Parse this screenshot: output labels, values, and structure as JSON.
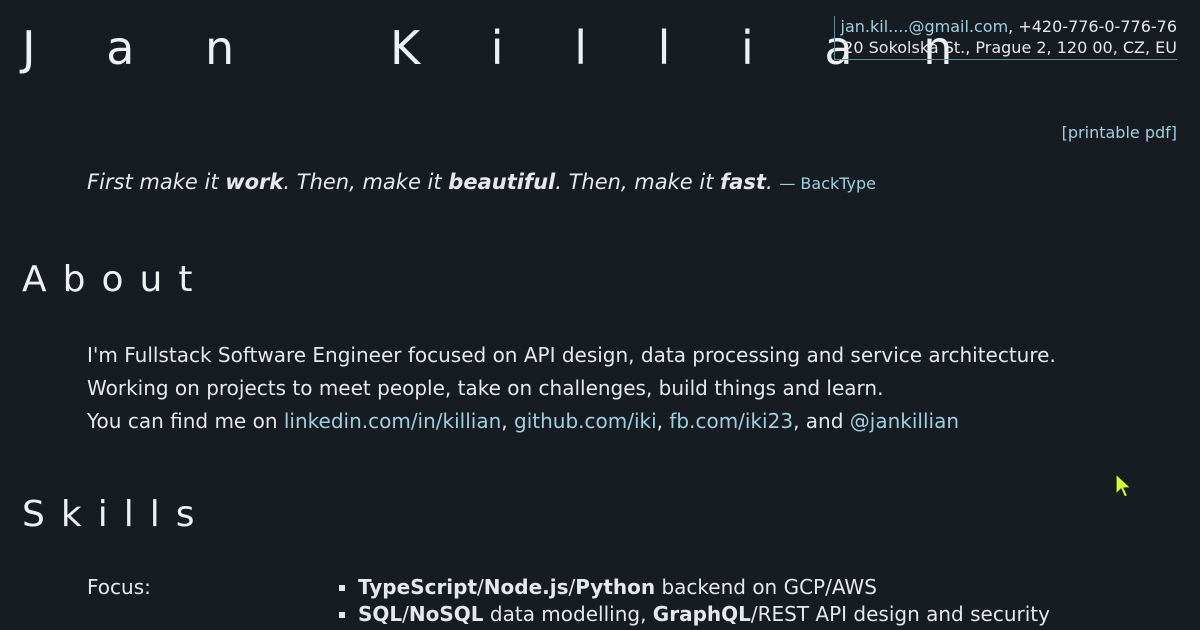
{
  "header": {
    "name": "J a n   K i l l i a n",
    "contact": {
      "email": "jan.kil....@gmail.com",
      "phone_sep": ", ",
      "phone": "+420-776-0-776-76",
      "address": "20 Sokolská St., Prague 2, 120 00, CZ, EU"
    },
    "printable_pdf": "[printable pdf]"
  },
  "quote": {
    "p1": "First make it ",
    "b1": "work",
    "p2": ". Then, make it ",
    "b2": "beautiful",
    "p3": ". Then, make it ",
    "b3": "fast",
    "p4": ". ",
    "attribution": "— BackType"
  },
  "about": {
    "title": "About",
    "line1": "I'm Fullstack Software Engineer focused on API design, data processing and service architecture.",
    "line2": "Working on projects to meet people, take on challenges, build things and learn.",
    "line3_prefix": "You can find me on ",
    "links": {
      "linkedin": "linkedin.com/in/killian",
      "github": "github.com/iki",
      "facebook": "fb.com/iki23",
      "twitter": "@jankillian"
    },
    "sep1": ", ",
    "sep2": ", ",
    "sep3": ", and "
  },
  "skills": {
    "title": "Skills",
    "focus_label": "Focus:",
    "items": [
      {
        "b1": "TypeScript",
        "s1": "/",
        "b2": "Node.js",
        "s2": "/",
        "b3": "Python",
        "rest": " backend on GCP/AWS"
      },
      {
        "b1": "SQL",
        "s1": "/",
        "b2": "NoSQL",
        "mid": " data modelling, ",
        "b3": "GraphQL",
        "rest": "/REST API design and security"
      }
    ]
  },
  "colors": {
    "background": "#171b22",
    "text": "#e6e9ec",
    "link": "#9fd0e0",
    "contact_border": "#5f8e98",
    "cursor": "#d4ff3a"
  },
  "icons": {
    "cursor": "mouse-pointer-icon"
  }
}
